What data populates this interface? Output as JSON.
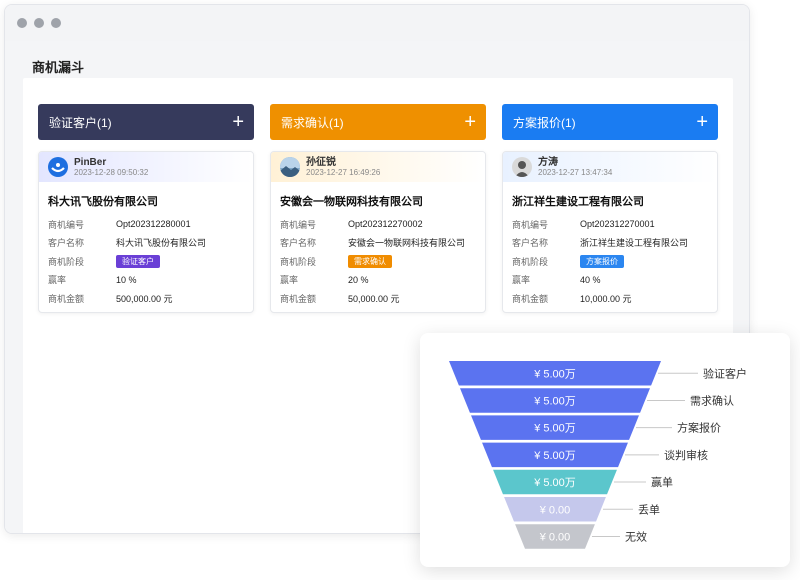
{
  "page": {
    "title": "商机漏斗"
  },
  "columns": [
    {
      "title": "验证客户(1)",
      "add_icon": "plus-icon",
      "color": "#363a5c",
      "card": {
        "owner": "PinBer",
        "time": "2023-12-28 09:50:32",
        "avatar": "logo-icon",
        "title": "科大讯飞股份有限公司",
        "fields": [
          {
            "label": "商机编号",
            "value": "Opt202312280001"
          },
          {
            "label": "客户名称",
            "value": "科大讯飞股份有限公司"
          },
          {
            "label": "商机阶段",
            "value": "验证客户",
            "tag": true,
            "tag_color": "#6a3fd6"
          },
          {
            "label": "赢率",
            "value": "10 %"
          },
          {
            "label": "商机金额",
            "value": "500,000.00  元"
          }
        ]
      }
    },
    {
      "title": "需求确认(1)",
      "add_icon": "plus-icon",
      "color": "#ef9000",
      "card": {
        "owner": "孙征锐",
        "time": "2023-12-27 16:49:26",
        "avatar": "landscape-avatar-icon",
        "title": "安徽会一物联网科技有限公司",
        "fields": [
          {
            "label": "商机编号",
            "value": "Opt202312270002"
          },
          {
            "label": "客户名称",
            "value": "安徽会一物联网科技有限公司"
          },
          {
            "label": "商机阶段",
            "value": "需求确认",
            "tag": true,
            "tag_color": "#f08c00"
          },
          {
            "label": "赢率",
            "value": "20 %"
          },
          {
            "label": "商机金额",
            "value": "50,000.00  元"
          }
        ]
      }
    },
    {
      "title": "方案报价(1)",
      "add_icon": "plus-icon",
      "color": "#1a7cf2",
      "card": {
        "owner": "方涛",
        "time": "2023-12-27 13:47:34",
        "avatar": "person-avatar-icon",
        "title": "浙江祥生建设工程有限公司",
        "fields": [
          {
            "label": "商机编号",
            "value": "Opt202312270001"
          },
          {
            "label": "客户名称",
            "value": "浙江祥生建设工程有限公司"
          },
          {
            "label": "商机阶段",
            "value": "方案报价",
            "tag": true,
            "tag_color": "#2b86f0"
          },
          {
            "label": "赢率",
            "value": "40 %"
          },
          {
            "label": "商机金额",
            "value": "10,000.00  元"
          }
        ]
      }
    }
  ],
  "chart_data": {
    "type": "funnel",
    "stages": [
      {
        "name": "验证客户",
        "value_label": "¥ 5.00万",
        "color": "#5b73f0"
      },
      {
        "name": "需求确认",
        "value_label": "¥ 5.00万",
        "color": "#5b73f0"
      },
      {
        "name": "方案报价",
        "value_label": "¥ 5.00万",
        "color": "#5b73f0"
      },
      {
        "name": "谈判审核",
        "value_label": "¥ 5.00万",
        "color": "#5b73f0"
      },
      {
        "name": "赢单",
        "value_label": "¥ 5.00万",
        "color": "#5bc6cc"
      },
      {
        "name": "丢单",
        "value_label": "¥ 0.00",
        "color": "#c5c8ec"
      },
      {
        "name": "无效",
        "value_label": "¥ 0.00",
        "color": "#c4c6cc"
      }
    ]
  }
}
